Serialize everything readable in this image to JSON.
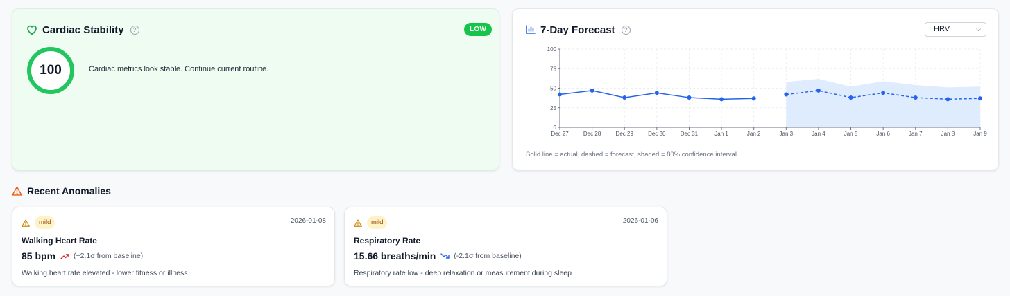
{
  "colors": {
    "accent_green": "#22c55e",
    "badge_green": "#16c44a",
    "chart_blue": "#2563eb",
    "confidence_fill": "#dbeafe",
    "warn_orange": "#ea580c",
    "trend_up": "#dc2626",
    "trend_down": "#2563eb"
  },
  "cardiac": {
    "title": "Cardiac Stability",
    "help": "?",
    "risk_label": "LOW",
    "score": "100",
    "message": "Cardiac metrics look stable. Continue current routine.",
    "icon": "heart-icon"
  },
  "forecast": {
    "title": "7-Day Forecast",
    "help": "?",
    "icon": "bar-chart-icon",
    "selected_metric": "HRV",
    "caption": "Solid line = actual, dashed = forecast, shaded = 80% confidence interval"
  },
  "chart_data": {
    "type": "line",
    "x": [
      "Dec 27",
      "Dec 28",
      "Dec 29",
      "Dec 30",
      "Dec 31",
      "Jan 1",
      "Jan 2",
      "Jan 3",
      "Jan 4",
      "Jan 5",
      "Jan 6",
      "Jan 7",
      "Jan 8",
      "Jan 9"
    ],
    "series": [
      {
        "style": "solid",
        "start_index": 0,
        "values": [
          42,
          47,
          38,
          44,
          38,
          36,
          37
        ]
      },
      {
        "style": "dashed",
        "start_index": 7,
        "values": [
          42,
          47,
          38,
          44,
          38,
          36,
          37
        ]
      }
    ],
    "confidence_band": {
      "start_index": 7,
      "lower": [
        0,
        0,
        0,
        0,
        0,
        0,
        0
      ],
      "upper": [
        58,
        62,
        52,
        59,
        54,
        51,
        52
      ]
    },
    "y_ticks": [
      "0",
      "25",
      "50",
      "75",
      "100"
    ],
    "ylim": [
      0,
      100
    ],
    "grid": true
  },
  "anomalies": {
    "heading": "Recent Anomalies",
    "icon": "warning-triangle-icon",
    "items": [
      {
        "severity": "mild",
        "date": "2026-01-08",
        "name": "Walking Heart Rate",
        "value": "85 bpm",
        "trend": "up",
        "deviation": "(+2.1σ from baseline)",
        "description": "Walking heart rate elevated - lower fitness or illness"
      },
      {
        "severity": "mild",
        "date": "2026-01-06",
        "name": "Respiratory Rate",
        "value": "15.66 breaths/min",
        "trend": "down",
        "deviation": "(-2.1σ from baseline)",
        "description": "Respiratory rate low - deep relaxation or measurement during sleep"
      }
    ]
  }
}
